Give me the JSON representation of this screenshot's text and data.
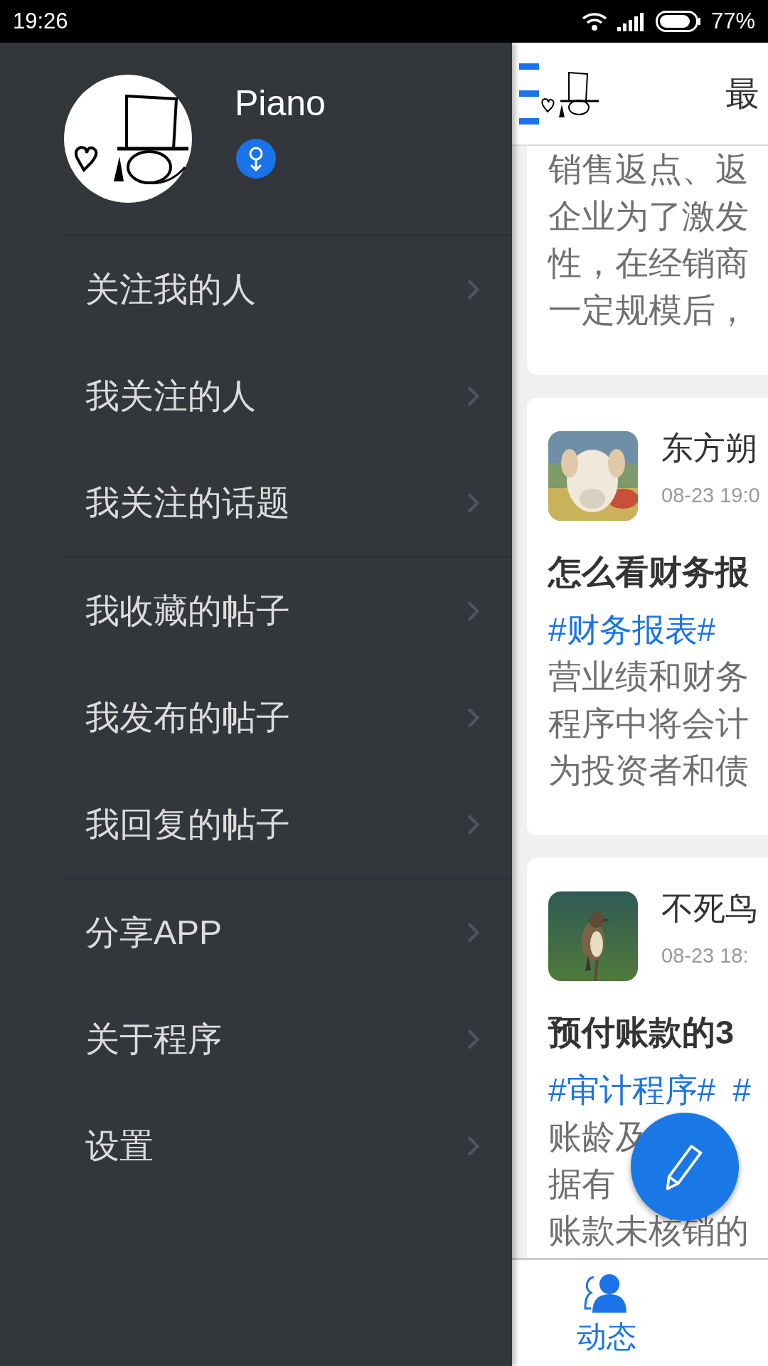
{
  "status_bar": {
    "time": "19:26",
    "battery": "77%"
  },
  "profile": {
    "name": "Piano",
    "badge": {
      "kind": "female"
    }
  },
  "menu_groups": [
    [
      "关注我的人",
      "我关注的人",
      "我关注的话题"
    ],
    [
      "我收藏的帖子",
      "我发布的帖子",
      "我回复的帖子"
    ],
    [
      "分享APP",
      "关于程序",
      "设置"
    ]
  ],
  "header": {
    "title": "最"
  },
  "posts": [
    {
      "body": [
        "销售返点、返",
        "企业为了激发",
        "性，在经销商",
        "一定规模后，"
      ]
    },
    {
      "author": "东方朔",
      "time": "08-23 19:0",
      "title": "怎么看财务报",
      "tags": [
        "#财务报表#"
      ],
      "body": [
        "营业绩和财务",
        "程序中将会计",
        "为投资者和债"
      ]
    },
    {
      "author": "不死鸟",
      "time": "08-23 18:",
      "title": "预付账款的3",
      "tags": [
        "#审计程序#",
        "#"
      ],
      "body": [
        "账龄及",
        "据有",
        "账款未核销的"
      ]
    }
  ],
  "bottom_nav": [
    {
      "label": "动态",
      "selected": true
    }
  ]
}
